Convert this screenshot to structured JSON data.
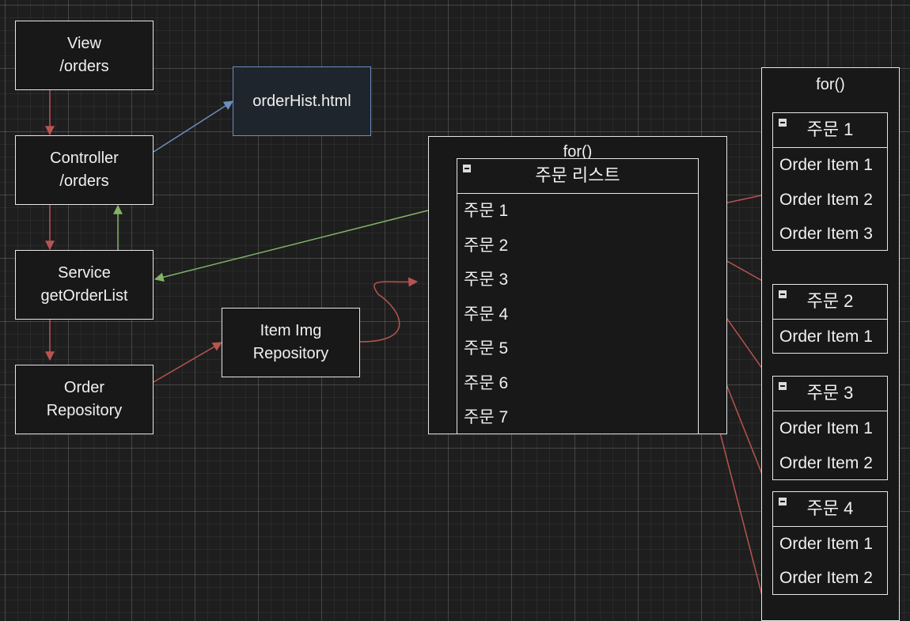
{
  "nodes": {
    "view": "View\n/orders",
    "controller": "Controller\n/orders",
    "service": "Service\ngetOrderList",
    "order_repo": "Order\nRepository",
    "item_img_repo": "Item Img\nRepository",
    "order_hist": "orderHist.html"
  },
  "center_frame": {
    "title": "for()",
    "list": {
      "header": "주문 리스트",
      "items": [
        "주문 1",
        "주문 2",
        "주문 3",
        "주문 4",
        "주문 5",
        "주문 6",
        "주문 7"
      ]
    }
  },
  "right_frame": {
    "title": "for()",
    "orders": [
      {
        "header": "주문 1",
        "items": [
          "Order Item 1",
          "Order Item 2",
          "Order Item 3"
        ]
      },
      {
        "header": "주문 2",
        "items": [
          "Order Item 1"
        ]
      },
      {
        "header": "주문 3",
        "items": [
          "Order Item 1",
          "Order Item 2"
        ]
      },
      {
        "header": "주문 4",
        "items": [
          "Order Item 1",
          "Order Item 2"
        ]
      }
    ]
  },
  "colors": {
    "red_arrow": "#b85450",
    "green_arrow": "#82b366",
    "blue_arrow": "#6c8ebf",
    "box_border": "#e6e6e6",
    "box_fill": "#181818",
    "canvas": "#1e1e1e"
  }
}
